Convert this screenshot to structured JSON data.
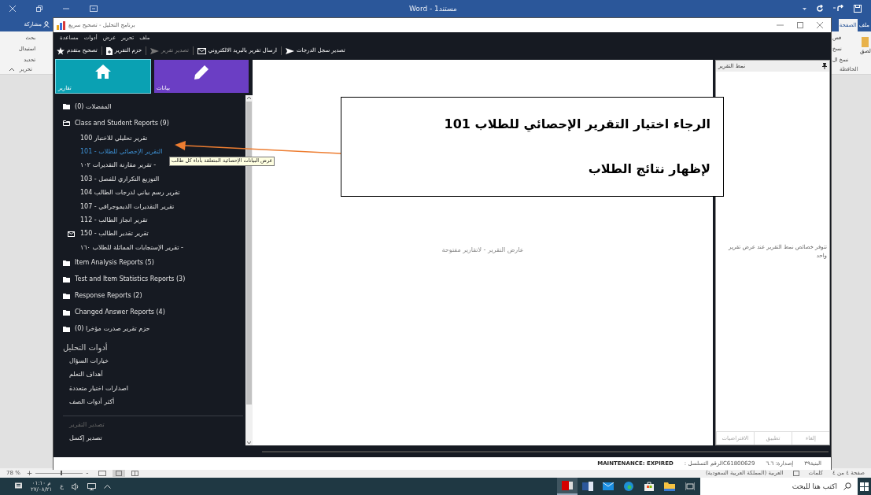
{
  "word": {
    "title": "Word - مستند1",
    "tabs": [
      {
        "label": "ملف",
        "selected": false
      },
      {
        "label": "الصفحة",
        "selected": true
      }
    ],
    "share_button": "مشاركة",
    "editing_group": {
      "items": [
        "بحث",
        "استبدال",
        "تحديد"
      ],
      "label": "تحرير"
    },
    "clipboard_group": {
      "paste": "لصق",
      "items": [
        "قص",
        "نسخ",
        "نسخ ال"
      ],
      "label": "الحافظة"
    },
    "status_bar": {
      "zoom": "78 %",
      "zoom_out": "+",
      "zoom_slider": {
        "level": 0.55
      },
      "zoom_in": "-",
      "page": "صفحة ٤ من ٤",
      "words": "كلمات",
      "language": "العربية (المملكة العربية السعودية)"
    }
  },
  "app": {
    "title": "برنامج التحليل - تصحيح سريع",
    "menu": [
      "ملف",
      "تحرير",
      "عرض",
      "أدوات",
      "مساعدة"
    ],
    "toolbar": [
      {
        "label": "تصدير سجل الدرجات",
        "kind": "send",
        "disabled": false
      },
      {
        "label": "ارسال تقرير بالبريد الالكتروني",
        "kind": "mail",
        "disabled": false
      },
      {
        "label": "تصدير تقرير",
        "kind": "send",
        "disabled": true
      },
      {
        "label": "حزم التقرير",
        "kind": "document",
        "disabled": false
      },
      {
        "label": "تصحيح متقدم",
        "kind": "star",
        "disabled": false
      }
    ],
    "tiles": [
      {
        "label": "بيانات",
        "kind": "edit",
        "selected": false
      },
      {
        "label": "تقارير",
        "kind": "home",
        "selected": true
      }
    ],
    "tree": [
      {
        "label": "المفضلات (0)",
        "expanded": false
      },
      {
        "label": "Class and Student Reports (9)",
        "expanded": true,
        "children": [
          {
            "label": "تقرير تحليلي للاختبار 100",
            "kind": "report",
            "selected": false
          },
          {
            "label": "التقرير الإحصائي للطلاب - 101",
            "kind": "report",
            "selected": true
          },
          {
            "label": "تقرير مقارنة التقديرات ١٠٢ -",
            "kind": "report",
            "selected": false
          },
          {
            "label": "التوزيع التكراري للفصل - 103",
            "kind": "report",
            "selected": false
          },
          {
            "label": "تقرير رسم بياني لدرجات الطالب 104",
            "kind": "report",
            "selected": false
          },
          {
            "label": "تقرير التقديرات الديموجرافي - 107",
            "kind": "report",
            "selected": false
          },
          {
            "label": "تقرير انجاز الطالب - 112",
            "kind": "report",
            "selected": false
          },
          {
            "label": "تقرير تقدير الطالب - 150",
            "kind": "mail_report",
            "selected": false
          },
          {
            "label": "تقرير الإستجابات المماثلة للطلاب ١٦٠ -",
            "kind": "report",
            "selected": false
          }
        ]
      },
      {
        "label": "Item Analysis Reports (5)",
        "expanded": false
      },
      {
        "label": "Test and Item Statistics Reports (3)",
        "expanded": false
      },
      {
        "label": "Response Reports (2)",
        "expanded": false
      },
      {
        "label": "Changed Answer Reports (4)",
        "expanded": false
      },
      {
        "label": "حزم تقرير صدرت مؤخرا (0)",
        "expanded": false
      }
    ],
    "tooltip": "عرض البيانات الإحصائية المتعلقة بأداء كل طالب",
    "tools": {
      "heading": "أدوات التحليل",
      "items": [
        "خيارات السؤال",
        "أهداف التعلم",
        "اصدارات اختيار متعددة",
        "أكثر أدوات الصف"
      ]
    },
    "export": {
      "heading": "تصدير التقرير",
      "heading_disabled": true,
      "items": [
        "تصدير إكسل"
      ]
    },
    "viewer_message": "عارض التقرير - لاتقارير مفتوحة",
    "style_panel": {
      "title": "نمط التقرير",
      "message": "تتوفر خصائص نمط التقرير عند عرض تقرير واحد",
      "buttons": [
        {
          "label": "إلغاء",
          "disabled": true
        },
        {
          "label": "تطبيق",
          "disabled": true
        },
        {
          "label": "الافتراضيات",
          "disabled": true
        }
      ]
    },
    "status_bar": [
      "البنية٣٩",
      "إصدارة: ٦.٦",
      "C61800629الرقم التسلسل :",
      "MAINTENANCE: EXPIRED"
    ]
  },
  "callout": {
    "lines": [
      "الرجاء اختيار التقرير الإحصائي للطلاب 101",
      "لإظهار نتائج الطلاب"
    ]
  },
  "taskbar": {
    "time": "م ٠١:١٠",
    "date": "٢٧/٠٨/٢١",
    "input_language": "ع",
    "apps": [
      {
        "kind": "report_app",
        "selected": true
      },
      {
        "kind": "word",
        "selected": false
      },
      {
        "kind": "mail",
        "selected": false
      },
      {
        "kind": "browser",
        "selected": false
      },
      {
        "kind": "store",
        "selected": false
      },
      {
        "kind": "folder",
        "selected": false
      },
      {
        "kind": "task_view",
        "selected": false
      }
    ],
    "search_placeholder": "اكتب هنا للبحث"
  }
}
